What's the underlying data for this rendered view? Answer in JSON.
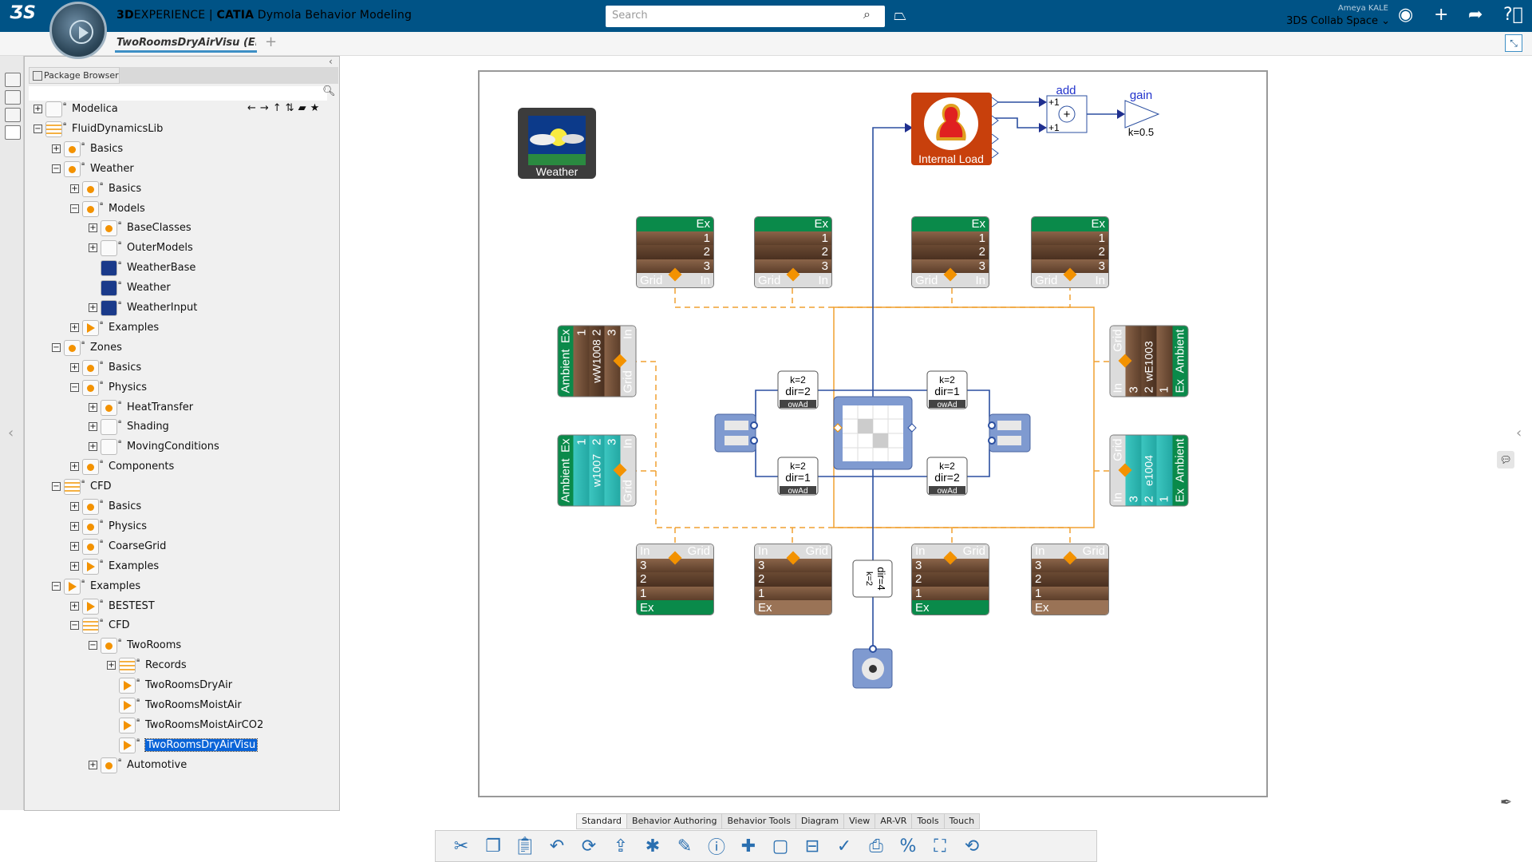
{
  "header": {
    "brand_prefix": "3D",
    "brand_rest": "EXPERIENCE | ",
    "brand_app": "CATIA",
    "brand_suffix": " Dymola Behavior Modeling",
    "search_placeholder": "Search",
    "user_name": "Ameya KALE",
    "collab_space": "3DS Collab Space ⌄",
    "icons": [
      "ds-logo-icon",
      "compass-icon",
      "search-icon",
      "tag-icon",
      "user-icon",
      "plus-icon",
      "share-icon",
      "help-icon"
    ]
  },
  "tabs": {
    "document_tab": "TwoRoomsDryAirVisu (Enc",
    "add": "+"
  },
  "package_browser": {
    "title": "Package Browser",
    "search_value": "",
    "nav_icons": "←→↑⇅▰★",
    "tree": [
      {
        "level": 0,
        "exp": "+",
        "label": "Modelica",
        "icon": "modelica"
      },
      {
        "level": 0,
        "exp": "-",
        "label": "FluidDynamicsLib",
        "icon": "library"
      },
      {
        "level": 1,
        "exp": "+",
        "label": "Basics",
        "icon": "package"
      },
      {
        "level": 1,
        "exp": "-",
        "label": "Weather",
        "icon": "package"
      },
      {
        "level": 2,
        "exp": "+",
        "label": "Basics",
        "icon": "package"
      },
      {
        "level": 2,
        "exp": "-",
        "label": "Models",
        "icon": "package"
      },
      {
        "level": 3,
        "exp": "+",
        "label": "BaseClasses",
        "icon": "package"
      },
      {
        "level": 3,
        "exp": "+",
        "label": "OuterModels",
        "icon": "blank"
      },
      {
        "level": 3,
        "exp": "",
        "label": "WeatherBase",
        "icon": "weather"
      },
      {
        "level": 3,
        "exp": "",
        "label": "Weather",
        "icon": "weather"
      },
      {
        "level": 3,
        "exp": "+",
        "label": "WeatherInput",
        "icon": "weather"
      },
      {
        "level": 2,
        "exp": "+",
        "label": "Examples",
        "icon": "example"
      },
      {
        "level": 1,
        "exp": "-",
        "label": "Zones",
        "icon": "package"
      },
      {
        "level": 2,
        "exp": "+",
        "label": "Basics",
        "icon": "package"
      },
      {
        "level": 2,
        "exp": "-",
        "label": "Physics",
        "icon": "package"
      },
      {
        "level": 3,
        "exp": "+",
        "label": "HeatTransfer",
        "icon": "package"
      },
      {
        "level": 3,
        "exp": "+",
        "label": "Shading",
        "icon": "blank"
      },
      {
        "level": 3,
        "exp": "+",
        "label": "MovingConditions",
        "icon": "blank"
      },
      {
        "level": 2,
        "exp": "+",
        "label": "Components",
        "icon": "package"
      },
      {
        "level": 1,
        "exp": "-",
        "label": "CFD",
        "icon": "grid"
      },
      {
        "level": 2,
        "exp": "+",
        "label": "Basics",
        "icon": "package"
      },
      {
        "level": 2,
        "exp": "+",
        "label": "Physics",
        "icon": "package"
      },
      {
        "level": 2,
        "exp": "+",
        "label": "CoarseGrid",
        "icon": "package"
      },
      {
        "level": 2,
        "exp": "+",
        "label": "Examples",
        "icon": "example"
      },
      {
        "level": 1,
        "exp": "-",
        "label": "Examples",
        "icon": "example"
      },
      {
        "level": 2,
        "exp": "+",
        "label": "BESTEST",
        "icon": "example"
      },
      {
        "level": 2,
        "exp": "-",
        "label": "CFD",
        "icon": "grid"
      },
      {
        "level": 3,
        "exp": "-",
        "label": "TwoRooms",
        "icon": "package"
      },
      {
        "level": 4,
        "exp": "+",
        "label": "Records",
        "icon": "grid"
      },
      {
        "level": 4,
        "exp": "",
        "label": "TwoRoomsDryAir",
        "icon": "example"
      },
      {
        "level": 4,
        "exp": "",
        "label": "TwoRoomsMoistAir",
        "icon": "example"
      },
      {
        "level": 4,
        "exp": "",
        "label": "TwoRoomsMoistAirCO2",
        "icon": "example"
      },
      {
        "level": 4,
        "exp": "",
        "label": "TwoRoomsDryAirVisu",
        "icon": "example",
        "selected": true
      },
      {
        "level": 3,
        "exp": "+",
        "label": "Automotive",
        "icon": "package"
      }
    ]
  },
  "diagram": {
    "weather_label": "Weather",
    "internal_load_label": "Internal Load",
    "add_label": "add",
    "add_in1": "+1",
    "add_in2": "+1",
    "add_symbol": "+",
    "gain_label": "gain",
    "gain_param": "k=0.5",
    "walls": {
      "top": [
        {
          "hdr": [
            "",
            "Ex"
          ],
          "rows": [
            "1",
            "2",
            "3"
          ],
          "ftr": [
            "Grid",
            "In"
          ],
          "mat": "brown"
        },
        {
          "hdr": [
            "",
            "Ex"
          ],
          "rows": [
            "1",
            "2",
            "3"
          ],
          "ftr": [
            "Grid",
            "In"
          ],
          "mat": "brown"
        },
        {
          "hdr": [
            "",
            "Ex"
          ],
          "rows": [
            "1",
            "2",
            "3"
          ],
          "ftr": [
            "Grid",
            "In"
          ],
          "mat": "brown"
        },
        {
          "hdr": [
            "",
            "Ex"
          ],
          "rows": [
            "1",
            "2",
            "3"
          ],
          "ftr": [
            "Grid",
            "In"
          ],
          "mat": "brown"
        }
      ],
      "bottom": [
        {
          "hdr": [
            "In",
            "Grid"
          ],
          "rows": [
            "3",
            "2",
            "1"
          ],
          "ftr": [
            "Ex",
            ""
          ],
          "ftr_type": "green",
          "mat": "brown"
        },
        {
          "hdr": [
            "In",
            "Grid"
          ],
          "rows": [
            "3",
            "2",
            "1"
          ],
          "ftr": [
            "Ex",
            ""
          ],
          "ftr_type": "brown",
          "mat": "brown"
        },
        {
          "hdr": [
            "In",
            "Grid"
          ],
          "rows": [
            "3",
            "2",
            "1"
          ],
          "ftr": [
            "Ex",
            ""
          ],
          "ftr_type": "green",
          "mat": "brown"
        },
        {
          "hdr": [
            "In",
            "Grid"
          ],
          "rows": [
            "3",
            "2",
            "1"
          ],
          "ftr": [
            "Ex",
            ""
          ],
          "ftr_type": "brown",
          "mat": "brown"
        }
      ],
      "left": [
        {
          "hdr": [
            "Ambient",
            "Ex"
          ],
          "rows": [
            "1",
            "2",
            "3"
          ],
          "ftr": [
            "Grid",
            "In"
          ],
          "label": "wW1008",
          "mat": "brown"
        },
        {
          "hdr": [
            "Ambient",
            "Ex"
          ],
          "rows": [
            "1",
            "2",
            "3"
          ],
          "ftr": [
            "Grid",
            "In"
          ],
          "label": "w1007",
          "mat": "teal"
        }
      ],
      "right": [
        {
          "hdr": [
            "In",
            "Grid"
          ],
          "rows": [
            "3",
            "2",
            "1"
          ],
          "ftr": [
            "Ex",
            "Ambient"
          ],
          "label": "wE1003",
          "mat": "brown"
        },
        {
          "hdr": [
            "In",
            "Grid"
          ],
          "rows": [
            "3",
            "2",
            "1"
          ],
          "ftr": [
            "Ex",
            "Ambient"
          ],
          "label": "e1004",
          "mat": "teal"
        }
      ]
    },
    "flow_elements": [
      {
        "p1": "k=2",
        "p2": "dir=2",
        "tag": "owAd"
      },
      {
        "p1": "k=2",
        "p2": "dir=1",
        "tag": "owAd"
      },
      {
        "p1": "k=2",
        "p2": "dir=1",
        "tag": "owAd"
      },
      {
        "p1": "k=2",
        "p2": "dir=2",
        "tag": "owAd"
      }
    ],
    "vertical_flow": {
      "p1": "k=2",
      "p2": "dir=4"
    },
    "colors": {
      "wall_green": "#0a8a4a",
      "wall_brown": "#6b4a33",
      "wall_teal": "#2fb5b0",
      "heat_port": "#f39200",
      "connector_blue": "#1f3f8f",
      "internal_load": "#c8400c"
    }
  },
  "ribbon": {
    "tabs": [
      "Standard",
      "Behavior Authoring",
      "Behavior Tools",
      "Diagram",
      "View",
      "AR-VR",
      "Tools",
      "Touch"
    ],
    "active": "Standard",
    "tools": [
      "cut-icon",
      "copy-icon",
      "paste-icon",
      "undo-icon",
      "refresh-icon",
      "export-icon",
      "new-model-icon",
      "edit-icon",
      "info-icon",
      "add-component-icon",
      "rectangle-icon",
      "align-icon",
      "check-icon",
      "print-icon",
      "parameter-icon",
      "flowchart-icon",
      "simulate-icon"
    ]
  }
}
